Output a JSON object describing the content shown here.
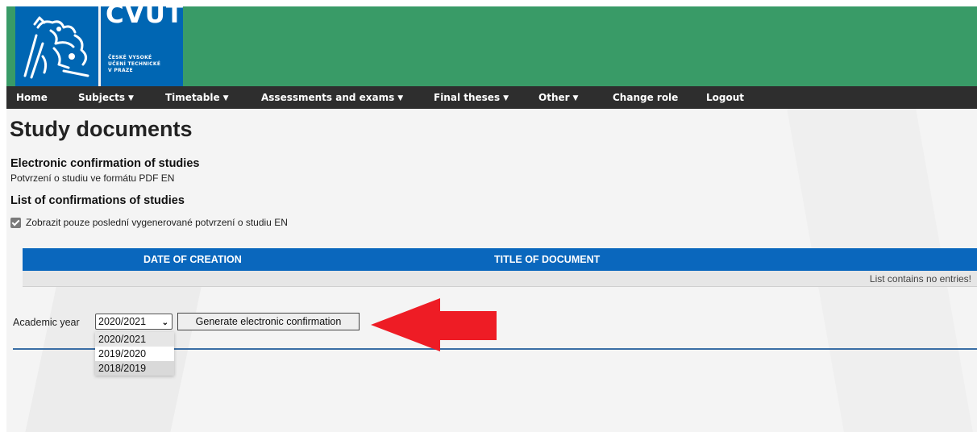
{
  "logo": {
    "title": "CVUT",
    "sub_line1": "ČESKÉ VYSOKÉ",
    "sub_line2": "UČENÍ TECHNICKÉ",
    "sub_line3": "V PRAZE"
  },
  "nav": {
    "items": [
      {
        "label": "Home",
        "has_caret": false
      },
      {
        "label": "Subjects",
        "has_caret": true
      },
      {
        "label": "Timetable",
        "has_caret": true
      },
      {
        "label": "Assessments and exams",
        "has_caret": true
      },
      {
        "label": "Final theses",
        "has_caret": true
      },
      {
        "label": "Other",
        "has_caret": true
      },
      {
        "label": "Change role",
        "has_caret": false
      },
      {
        "label": "Logout",
        "has_caret": false
      }
    ]
  },
  "page": {
    "title": "Study documents",
    "electronic_heading": "Electronic confirmation of studies",
    "pdf_link": "Potvrzení o studiu ve formátu PDF EN",
    "list_heading": "List of confirmations of studies",
    "checkbox_label": "Zobrazit pouze poslední vygenerované potvrzení o studiu EN",
    "checkbox_checked": true
  },
  "table": {
    "columns": [
      "DATE OF CREATION",
      "TITLE OF DOCUMENT"
    ],
    "empty_message": "List contains no entries!"
  },
  "form": {
    "year_label": "Academic year",
    "selected_year": "2020/2021",
    "options": [
      "2020/2021",
      "2019/2020",
      "2018/2019"
    ],
    "generate_button": "Generate electronic confirmation"
  },
  "colors": {
    "header_green": "#399b67",
    "logo_blue": "#0066b3",
    "nav_dark": "#2e2e2e",
    "table_header_blue": "#0a67bd",
    "annotation_arrow_red": "#ee1c25"
  }
}
